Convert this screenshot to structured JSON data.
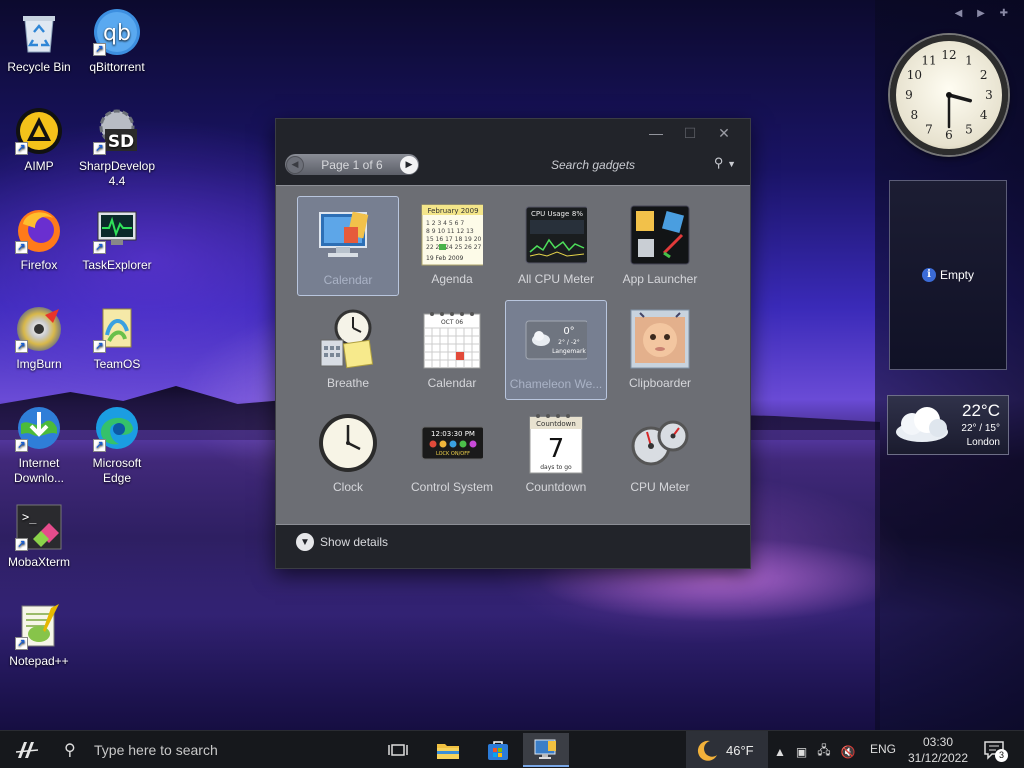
{
  "desktop_icons": [
    {
      "label": "Recycle Bin"
    },
    {
      "label": "qBittorrent"
    },
    {
      "label": "AIMP"
    },
    {
      "label": "SharpDevelop 4.4"
    },
    {
      "label": "Firefox"
    },
    {
      "label": "TaskExplorer"
    },
    {
      "label": "ImgBurn"
    },
    {
      "label": "TeamOS"
    },
    {
      "label": "Internet Downlo..."
    },
    {
      "label": "Microsoft Edge"
    },
    {
      "label": "MobaXterm"
    },
    {
      "label": "Notepad++"
    }
  ],
  "gadget_window": {
    "pager_label": "Page 1 of 6",
    "search_placeholder": "Search gadgets",
    "gadgets": [
      {
        "name": "Calendar",
        "selected": true
      },
      {
        "name": "Agenda",
        "selected": false
      },
      {
        "name": "All CPU Meter",
        "selected": false
      },
      {
        "name": "App Launcher",
        "selected": false
      },
      {
        "name": "Breathe",
        "selected": false
      },
      {
        "name": "Calendar",
        "selected": false
      },
      {
        "name": "Chameleon We...",
        "selected": true
      },
      {
        "name": "Clipboarder",
        "selected": false
      },
      {
        "name": "Clock",
        "selected": false
      },
      {
        "name": "Control System",
        "selected": false
      },
      {
        "name": "Countdown",
        "selected": false
      },
      {
        "name": "CPU Meter",
        "selected": false
      }
    ],
    "thumb_text": {
      "agenda_title": "February 2009",
      "agenda_date": "19 Feb 2009",
      "cpu_title": "CPU Usage",
      "cpu_pct": "8%",
      "calendar_month": "OCT 06",
      "weather_temp": "0°",
      "weather_range": "2° / -2°",
      "weather_city": "Langemark",
      "control_time": "12:03:30 PM",
      "control_label": "LOCK ON/OFF",
      "countdown_title": "Countdown",
      "countdown_number": "7",
      "countdown_sub": "days to go"
    },
    "show_details_label": "Show details"
  },
  "sidebar": {
    "clock_numbers": [
      "12",
      "1",
      "2",
      "3",
      "4",
      "5",
      "6",
      "7",
      "8",
      "9",
      "10",
      "11"
    ],
    "clock_time": {
      "hour": 3,
      "minute": 30
    },
    "empty_label": "Empty",
    "weather": {
      "temp": "22°C",
      "range": "22° / 15°",
      "city": "London"
    }
  },
  "taskbar": {
    "search_placeholder": "Type here to search",
    "weather_temp": "46°F",
    "language": "ENG",
    "time": "03:30",
    "date": "31/12/2022",
    "notification_count": "3"
  },
  "colors": {
    "window_bg": "#22242a",
    "grid_bg": "#6c6e74",
    "taskbar_bg": "#16181c",
    "accent_blue": "#3b6bd6"
  }
}
